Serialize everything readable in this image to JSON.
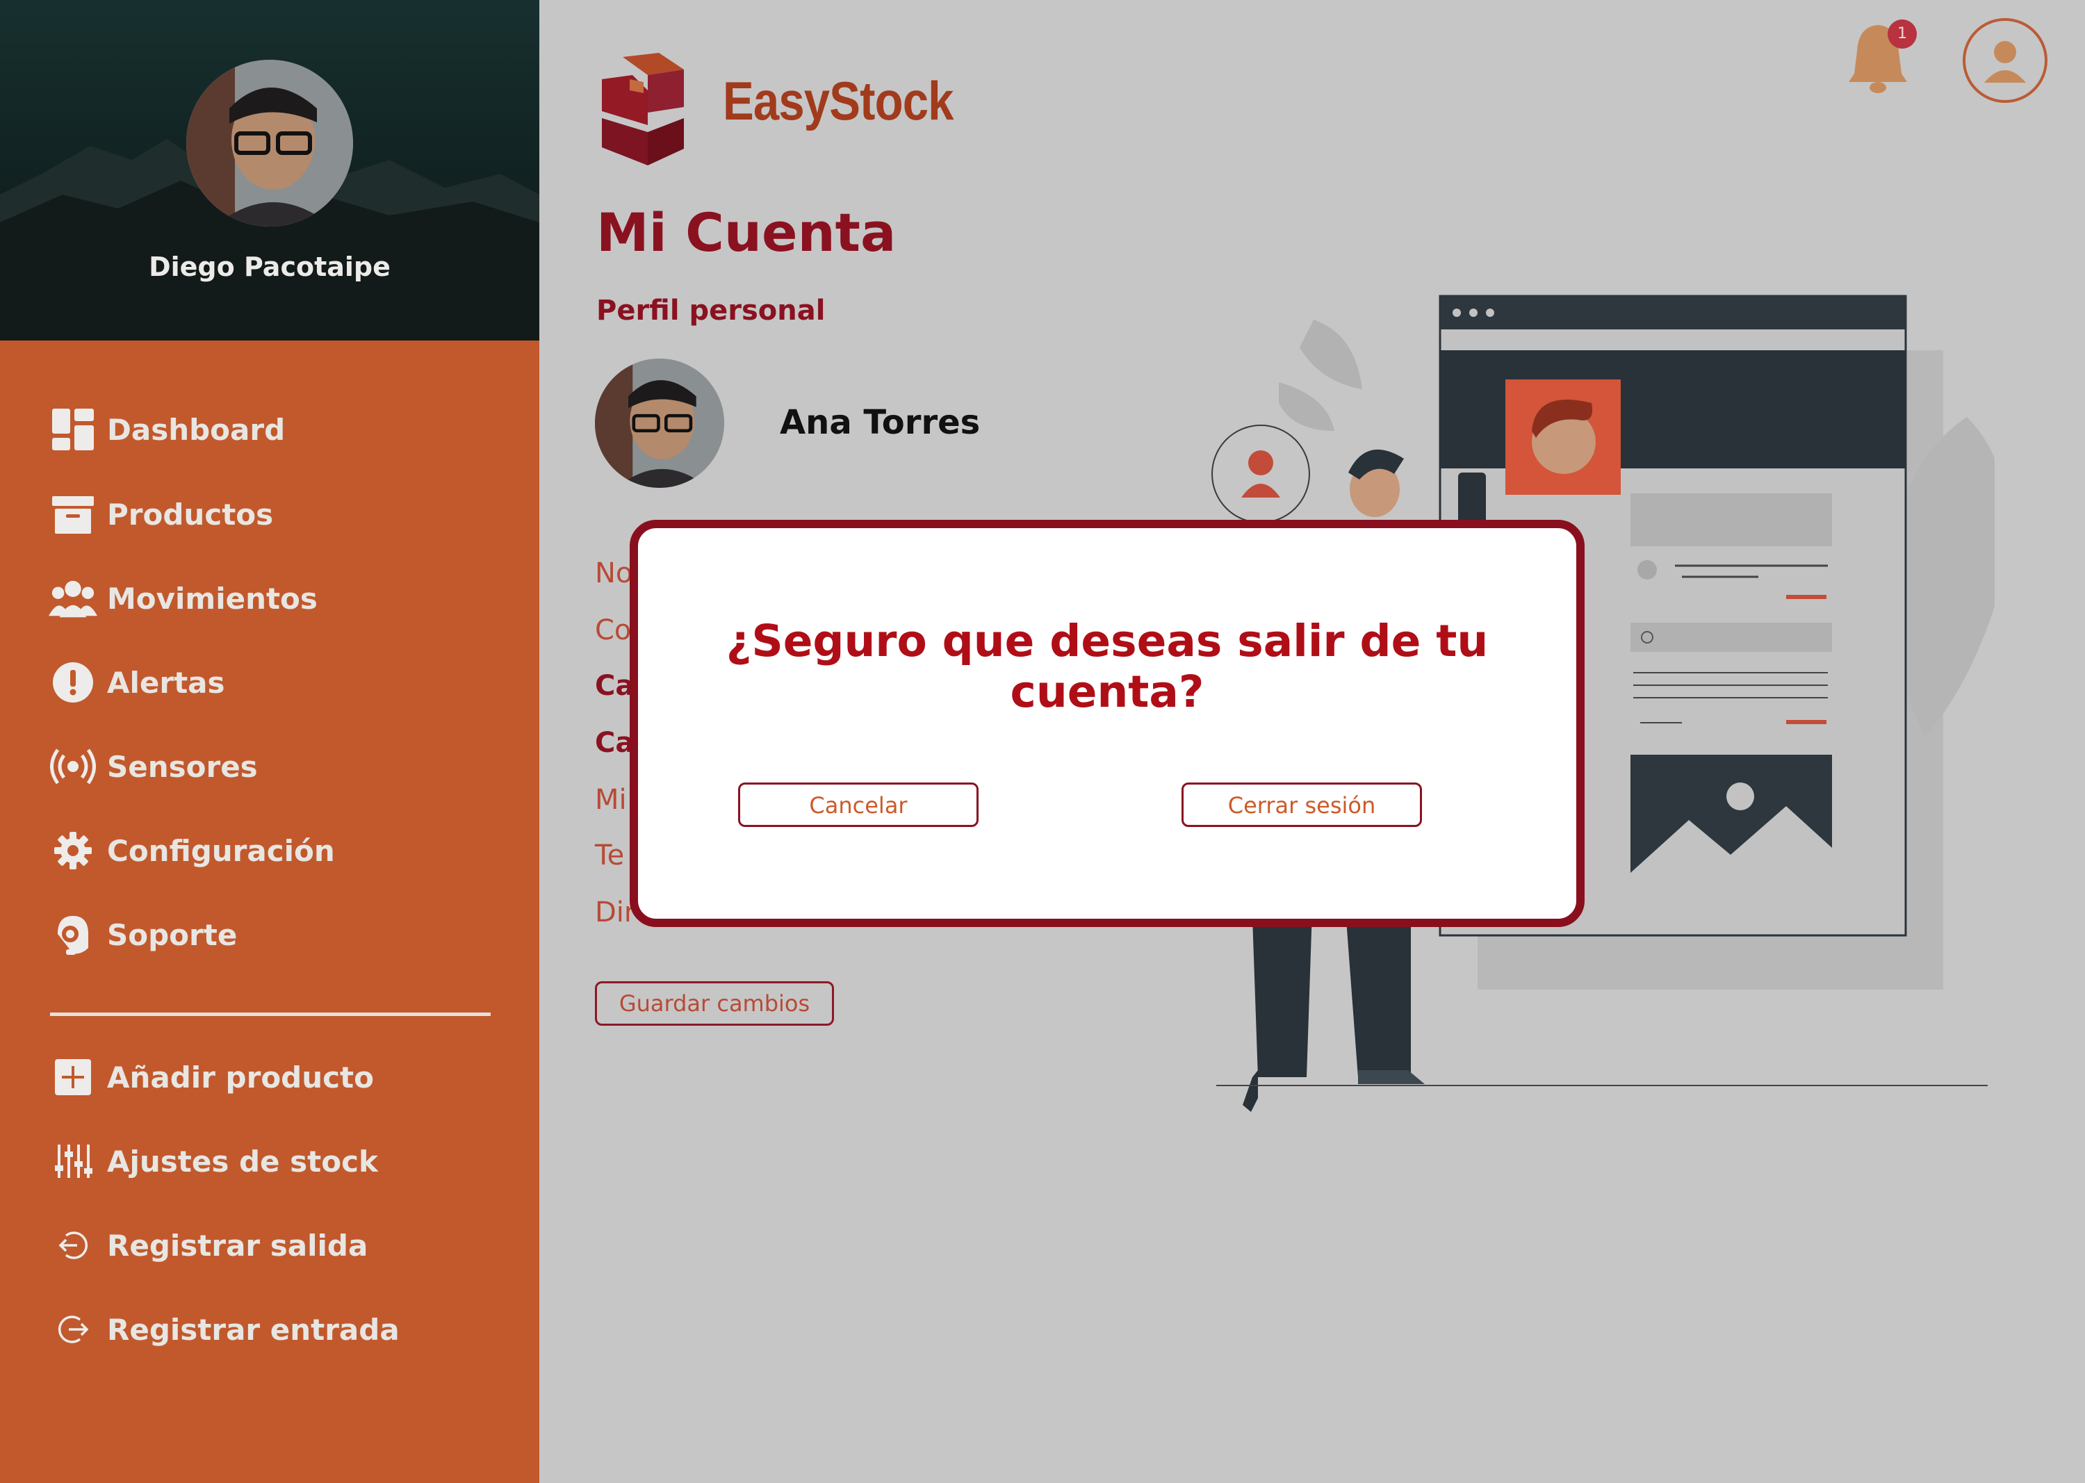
{
  "sidebar": {
    "user_name": "Diego Pacotaipe",
    "nav": [
      {
        "label": "Dashboard",
        "icon": "dashboard-icon"
      },
      {
        "label": "Productos",
        "icon": "box-icon"
      },
      {
        "label": "Movimientos",
        "icon": "users-icon"
      },
      {
        "label": "Alertas",
        "icon": "alert-icon"
      },
      {
        "label": "Sensores",
        "icon": "sensor-icon"
      },
      {
        "label": "Configuración",
        "icon": "gear-icon"
      },
      {
        "label": "Soporte",
        "icon": "headset-icon"
      }
    ],
    "actions": [
      {
        "label": "Añadir producto",
        "icon": "plus-icon"
      },
      {
        "label": "Ajustes de stock",
        "icon": "sliders-icon"
      },
      {
        "label": "Registrar salida",
        "icon": "exit-icon"
      },
      {
        "label": "Registrar entrada",
        "icon": "enter-icon"
      }
    ]
  },
  "header": {
    "brand": "EasyStock",
    "notifications_count": "1"
  },
  "main": {
    "title": "Mi Cuenta",
    "section": "Perfil personal",
    "account_name": "Ana Torres",
    "field_fragments": [
      "No",
      "Co",
      "Ca",
      "Ca",
      "Mi",
      "Te",
      "Dir"
    ],
    "save_label": "Guardar cambios"
  },
  "modal": {
    "question": "¿Seguro que deseas salir de tu cuenta?",
    "cancel_label": "Cancelar",
    "confirm_label": "Cerrar sesión"
  },
  "colors": {
    "sidebar": "#c1592d",
    "accent_dark": "#8a1220",
    "modal_border": "#8a0f1e",
    "overlay": "#c6c6c6"
  }
}
